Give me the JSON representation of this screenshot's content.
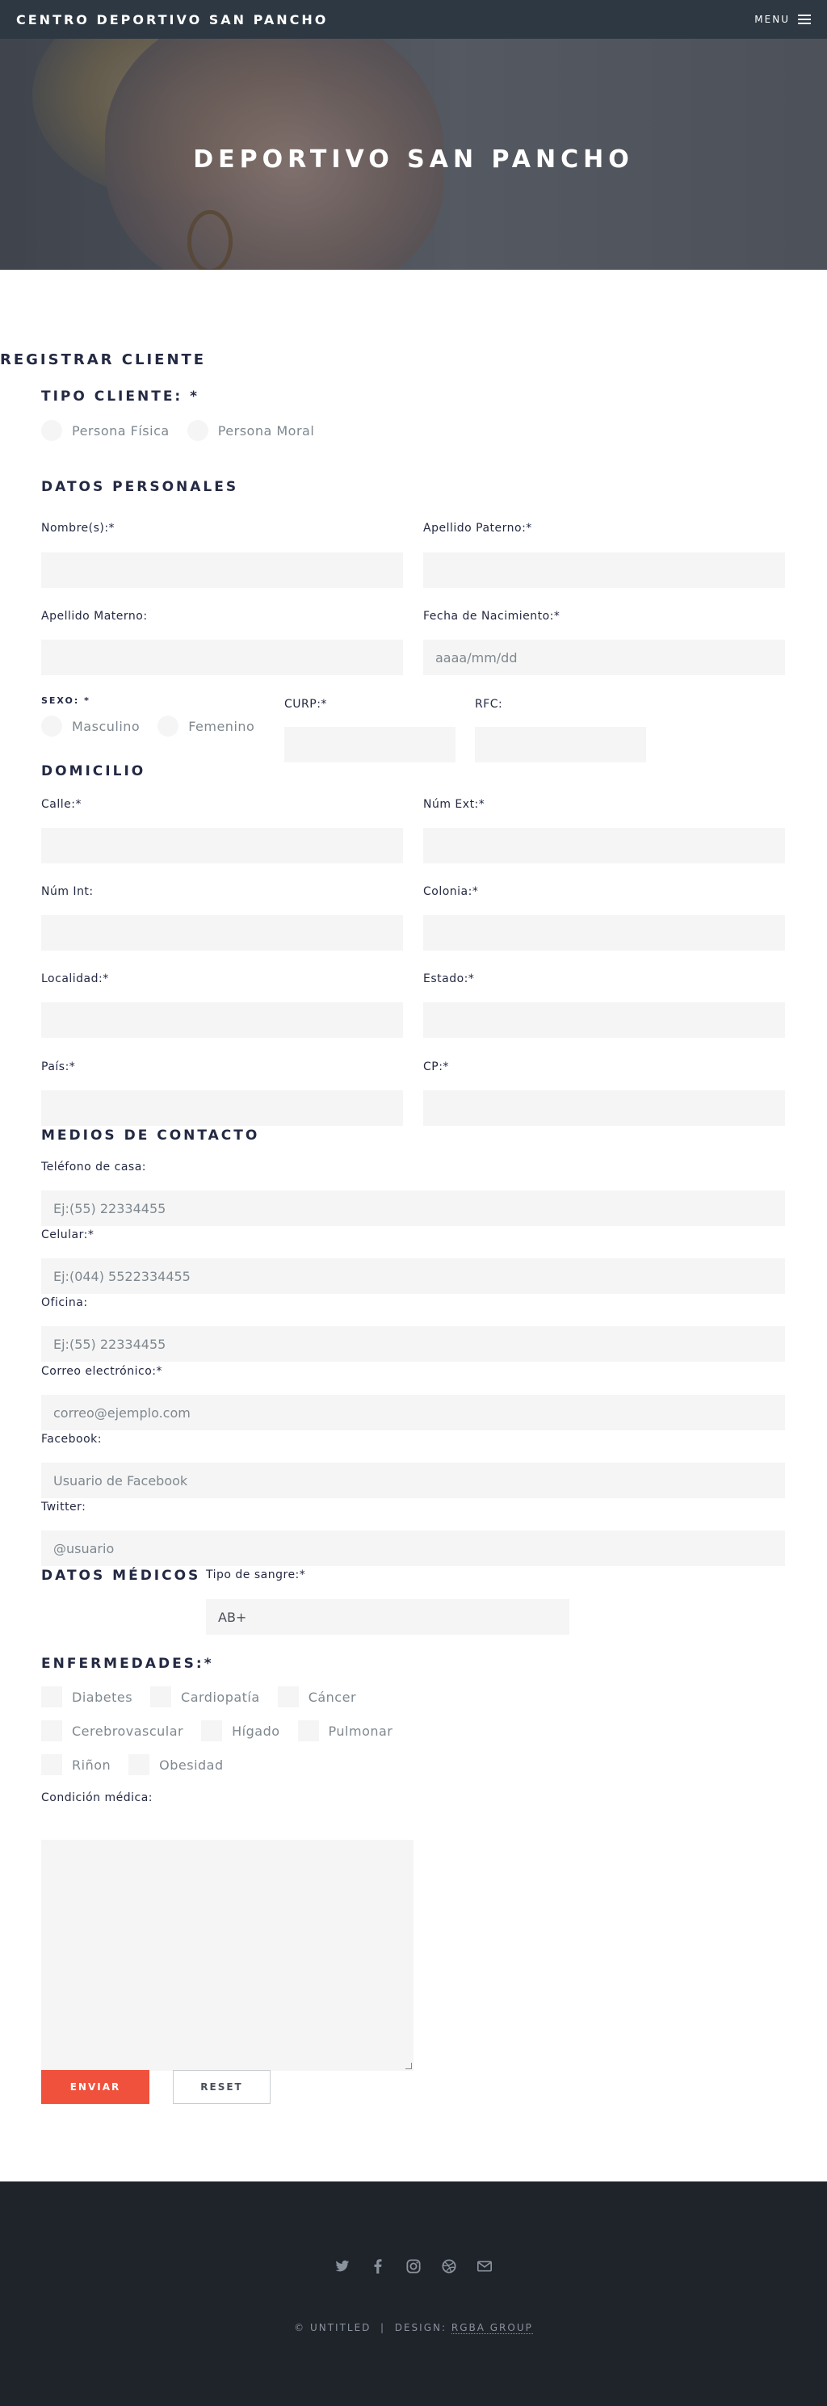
{
  "header": {
    "brand": "CENTRO DEPORTIVO SAN PANCHO",
    "menu_label": "MENU"
  },
  "banner": {
    "title": "DEPORTIVO SAN PANCHO"
  },
  "form": {
    "title": "REGISTRAR CLIENTE",
    "tipo_cliente": {
      "heading": "TIPO CLIENTE: *",
      "options": [
        "Persona Física",
        "Persona Moral"
      ]
    },
    "datos_personales": {
      "heading": "DATOS PERSONALES",
      "nombre_label": "Nombre(s):*",
      "apellido_paterno_label": "Apellido Paterno:*",
      "apellido_materno_label": "Apellido Materno:",
      "fecha_label": "Fecha de Nacimiento:*",
      "fecha_placeholder": "aaaa/mm/dd",
      "sexo_label": "SEXO: *",
      "sexo_options": [
        "Masculino",
        "Femenino"
      ],
      "curp_label": "CURP:*",
      "rfc_label": "RFC:"
    },
    "domicilio": {
      "heading": "DOMICILIO",
      "calle_label": "Calle:*",
      "num_ext_label": "Núm Ext:*",
      "num_int_label": "Núm Int:",
      "colonia_label": "Colonia:*",
      "localidad_label": "Localidad:*",
      "estado_label": "Estado:*",
      "pais_label": "País:*",
      "cp_label": "CP:*"
    },
    "contacto": {
      "heading": "MEDIOS DE CONTACTO",
      "tel_casa_label": "Teléfono de casa:",
      "tel_casa_placeholder": "Ej:(55) 22334455",
      "celular_label": "Celular:*",
      "celular_placeholder": "Ej:(044) 5522334455",
      "oficina_label": "Oficina:",
      "oficina_placeholder": "Ej:(55) 22334455",
      "correo_label": "Correo electrónico:*",
      "correo_placeholder": "correo@ejemplo.com",
      "facebook_label": "Facebook:",
      "facebook_placeholder": "Usuario de Facebook",
      "twitter_label": "Twitter:",
      "twitter_placeholder": "@usuario"
    },
    "medicos": {
      "heading": "DATOS MÉDICOS",
      "sangre_label": "Tipo de sangre:*",
      "sangre_value": "AB+"
    },
    "enfermedades": {
      "heading": "ENFERMEDADES:*",
      "row1": [
        "Diabetes",
        "Cardiopatía",
        "Cáncer"
      ],
      "row2": [
        "Cerebrovascular",
        "Hígado",
        "Pulmonar"
      ],
      "row3": [
        "Riñon",
        "Obesidad"
      ],
      "condicion_label": "Condición médica:"
    },
    "buttons": {
      "submit": "ENVIAR",
      "reset": "RESET"
    }
  },
  "footer": {
    "icons": [
      "twitter-icon",
      "facebook-icon",
      "instagram-icon",
      "dribbble-icon",
      "envelope-icon"
    ],
    "copyright": "© UNTITLED",
    "separator": "|",
    "design_label": "DESIGN:",
    "design_link": "RGBA GROUP"
  },
  "colors": {
    "header_bg": "#2e3842",
    "accent": "#f0513c",
    "footer_bg": "#1f232a",
    "field_bg": "#f5f5f5"
  }
}
